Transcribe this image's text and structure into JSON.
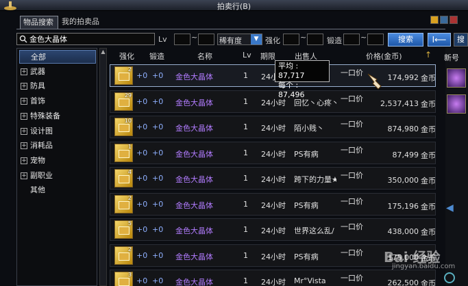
{
  "window": {
    "title": "拍卖行(B)"
  },
  "tabs": [
    {
      "label": "物品搜索"
    },
    {
      "label": "我的拍卖品"
    }
  ],
  "search": {
    "value": "金色大晶体",
    "lv_label": "Lv",
    "range_sep": "~",
    "rarity_label": "稀有度",
    "enhance_label": "强化",
    "lock_label": "锻造",
    "button": "搜索",
    "back": "I⟵"
  },
  "categories": [
    {
      "label": "全部",
      "expandable": false,
      "selected": true
    },
    {
      "label": "武器",
      "expandable": true
    },
    {
      "label": "防具",
      "expandable": true
    },
    {
      "label": "首饰",
      "expandable": true
    },
    {
      "label": "特殊装备",
      "expandable": true
    },
    {
      "label": "设计图",
      "expandable": true
    },
    {
      "label": "消耗品",
      "expandable": true
    },
    {
      "label": "宠物",
      "expandable": true
    },
    {
      "label": "副职业",
      "expandable": true
    },
    {
      "label": "其他",
      "expandable": false
    }
  ],
  "columns": {
    "enhance": "强化",
    "lock": "锻造",
    "name": "名称",
    "lv": "Lv",
    "period": "期限",
    "seller": "出售人",
    "price": "价格(金币)"
  },
  "rows": [
    {
      "count": "2",
      "enhance": "+0",
      "lock": "+0",
      "name": "金色大晶体",
      "lv": "1",
      "period": "24小时",
      "seller": "",
      "type": "一口价",
      "price": "174,992",
      "unit": "金币"
    },
    {
      "count": "29",
      "enhance": "+0",
      "lock": "+0",
      "name": "金色大晶体",
      "lv": "1",
      "period": "24小时",
      "seller": "回忆丶心疼丶",
      "type": "一口价",
      "price": "2,537,413",
      "unit": "金币"
    },
    {
      "count": "10",
      "enhance": "+0",
      "lock": "+0",
      "name": "金色大晶体",
      "lv": "1",
      "period": "24小时",
      "seller": "陌小贱丶",
      "type": "一口价",
      "price": "874,980",
      "unit": "金币"
    },
    {
      "count": "1",
      "enhance": "+0",
      "lock": "+0",
      "name": "金色大晶体",
      "lv": "1",
      "period": "24小时",
      "seller": "PS有病",
      "type": "一口价",
      "price": "87,499",
      "unit": "金币"
    },
    {
      "count": "4",
      "enhance": "+0",
      "lock": "+0",
      "name": "金色大晶体",
      "lv": "1",
      "period": "24小时",
      "seller": "跨下的力量★",
      "type": "一口价",
      "price": "350,000",
      "unit": "金币"
    },
    {
      "count": "2",
      "enhance": "+0",
      "lock": "+0",
      "name": "金色大晶体",
      "lv": "1",
      "period": "24小时",
      "seller": "PS有病",
      "type": "一口价",
      "price": "175,196",
      "unit": "金币"
    },
    {
      "count": "5",
      "enhance": "+0",
      "lock": "+0",
      "name": "金色大晶体",
      "lv": "1",
      "period": "24小时",
      "seller": "世界这么乱/",
      "type": "一口价",
      "price": "438,000",
      "unit": "金币"
    },
    {
      "count": "2",
      "enhance": "+0",
      "lock": "+0",
      "name": "金色大晶体",
      "lv": "1",
      "period": "24小时",
      "seller": "PS有病",
      "type": "一口价",
      "price": "175,000",
      "unit": "金币"
    },
    {
      "count": "3",
      "enhance": "+0",
      "lock": "+0",
      "name": "金色大晶体",
      "lv": "1",
      "period": "24小时",
      "seller": "Mr°Vista",
      "type": "一口价",
      "price": "262,500",
      "unit": "金币"
    }
  ],
  "tooltip": {
    "avg": "平均 : 87,717",
    "each": "每个 : 87,496"
  },
  "right_panel": {
    "title": "新号"
  },
  "watermark": {
    "main": "Bai 经验",
    "sub": "jingyan.baidu.com"
  }
}
